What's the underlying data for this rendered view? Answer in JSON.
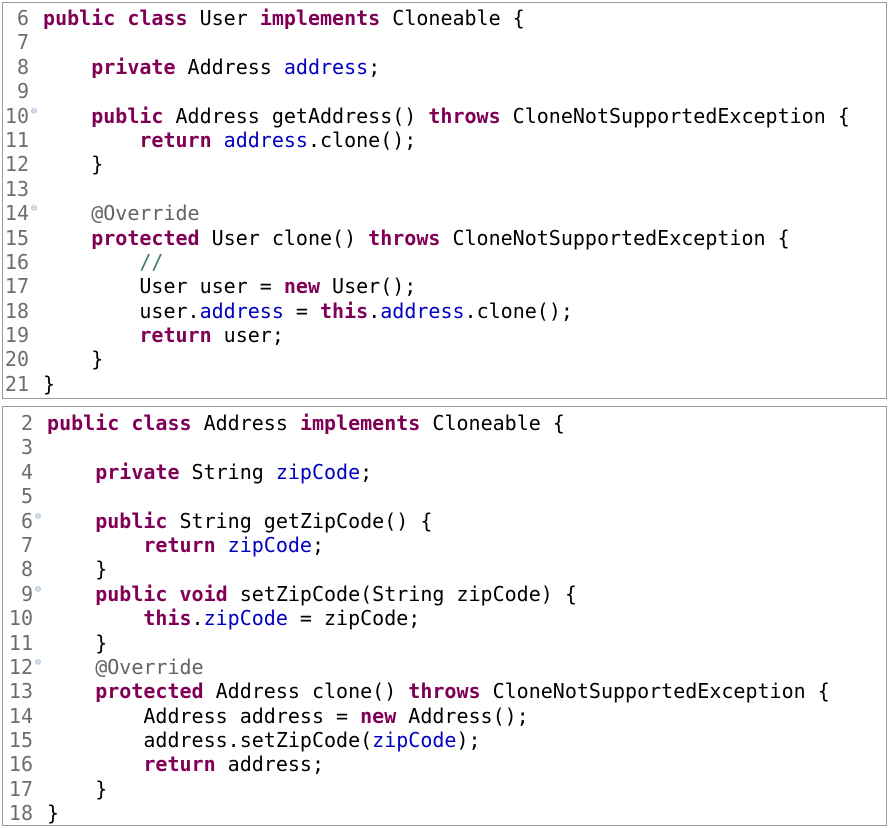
{
  "panels": [
    {
      "id": "user",
      "lines": [
        {
          "n": "6",
          "fold": false,
          "override": false,
          "tokens": [
            [
              "kw",
              "public"
            ],
            [
              "pl",
              " "
            ],
            [
              "kw",
              "class"
            ],
            [
              "pl",
              " User "
            ],
            [
              "kw",
              "implements"
            ],
            [
              "pl",
              " Cloneable {"
            ]
          ]
        },
        {
          "n": "7",
          "fold": false,
          "override": false,
          "tokens": []
        },
        {
          "n": "8",
          "fold": false,
          "override": false,
          "tokens": [
            [
              "pl",
              "    "
            ],
            [
              "kw",
              "private"
            ],
            [
              "pl",
              " Address "
            ],
            [
              "fld",
              "address"
            ],
            [
              "pl",
              ";"
            ]
          ]
        },
        {
          "n": "9",
          "fold": false,
          "override": false,
          "tokens": []
        },
        {
          "n": "10",
          "fold": true,
          "override": false,
          "tokens": [
            [
              "pl",
              "    "
            ],
            [
              "kw",
              "public"
            ],
            [
              "pl",
              " Address getAddress() "
            ],
            [
              "kw",
              "throws"
            ],
            [
              "pl",
              " CloneNotSupportedException {"
            ]
          ]
        },
        {
          "n": "11",
          "fold": false,
          "override": false,
          "tokens": [
            [
              "pl",
              "        "
            ],
            [
              "kw",
              "return"
            ],
            [
              "pl",
              " "
            ],
            [
              "fld",
              "address"
            ],
            [
              "pl",
              ".clone();"
            ]
          ]
        },
        {
          "n": "12",
          "fold": false,
          "override": false,
          "tokens": [
            [
              "pl",
              "    }"
            ]
          ]
        },
        {
          "n": "13",
          "fold": false,
          "override": false,
          "tokens": []
        },
        {
          "n": "14",
          "fold": true,
          "override": false,
          "tokens": [
            [
              "pl",
              "    "
            ],
            [
              "ann",
              "@Override"
            ]
          ]
        },
        {
          "n": "15",
          "fold": false,
          "override": true,
          "tokens": [
            [
              "pl",
              "    "
            ],
            [
              "kw",
              "protected"
            ],
            [
              "pl",
              " User clone() "
            ],
            [
              "kw",
              "throws"
            ],
            [
              "pl",
              " CloneNotSupportedException {"
            ]
          ]
        },
        {
          "n": "16",
          "fold": false,
          "override": false,
          "tokens": [
            [
              "pl",
              "        "
            ],
            [
              "cmt",
              "//"
            ]
          ]
        },
        {
          "n": "17",
          "fold": false,
          "override": false,
          "tokens": [
            [
              "pl",
              "        User user = "
            ],
            [
              "kw",
              "new"
            ],
            [
              "pl",
              " User();"
            ]
          ]
        },
        {
          "n": "18",
          "fold": false,
          "override": false,
          "tokens": [
            [
              "pl",
              "        user."
            ],
            [
              "fld",
              "address"
            ],
            [
              "pl",
              " = "
            ],
            [
              "kw",
              "this"
            ],
            [
              "pl",
              "."
            ],
            [
              "fld",
              "address"
            ],
            [
              "pl",
              ".clone();"
            ]
          ]
        },
        {
          "n": "19",
          "fold": false,
          "override": false,
          "tokens": [
            [
              "pl",
              "        "
            ],
            [
              "kw",
              "return"
            ],
            [
              "pl",
              " user;"
            ]
          ]
        },
        {
          "n": "20",
          "fold": false,
          "override": false,
          "tokens": [
            [
              "pl",
              "    }"
            ]
          ]
        },
        {
          "n": "21",
          "fold": false,
          "override": false,
          "tokens": [
            [
              "pl",
              "}"
            ]
          ]
        }
      ]
    },
    {
      "id": "address",
      "lines": [
        {
          "n": "2",
          "fold": false,
          "override": false,
          "tokens": [
            [
              "kw",
              "public"
            ],
            [
              "pl",
              " "
            ],
            [
              "kw",
              "class"
            ],
            [
              "pl",
              " Address "
            ],
            [
              "kw",
              "implements"
            ],
            [
              "pl",
              " Cloneable {"
            ]
          ]
        },
        {
          "n": "3",
          "fold": false,
          "override": false,
          "tokens": []
        },
        {
          "n": "4",
          "fold": false,
          "override": false,
          "tokens": [
            [
              "pl",
              "    "
            ],
            [
              "kw",
              "private"
            ],
            [
              "pl",
              " String "
            ],
            [
              "fld",
              "zipCode"
            ],
            [
              "pl",
              ";"
            ]
          ]
        },
        {
          "n": "5",
          "fold": false,
          "override": false,
          "tokens": []
        },
        {
          "n": "6",
          "fold": true,
          "override": false,
          "tokens": [
            [
              "pl",
              "    "
            ],
            [
              "kw",
              "public"
            ],
            [
              "pl",
              " String getZipCode() {"
            ]
          ]
        },
        {
          "n": "7",
          "fold": false,
          "override": false,
          "tokens": [
            [
              "pl",
              "        "
            ],
            [
              "kw",
              "return"
            ],
            [
              "pl",
              " "
            ],
            [
              "fld",
              "zipCode"
            ],
            [
              "pl",
              ";"
            ]
          ]
        },
        {
          "n": "8",
          "fold": false,
          "override": false,
          "tokens": [
            [
              "pl",
              "    }"
            ]
          ]
        },
        {
          "n": "9",
          "fold": true,
          "override": false,
          "tokens": [
            [
              "pl",
              "    "
            ],
            [
              "kw",
              "public"
            ],
            [
              "pl",
              " "
            ],
            [
              "kw",
              "void"
            ],
            [
              "pl",
              " setZipCode(String zipCode) {"
            ]
          ]
        },
        {
          "n": "10",
          "fold": false,
          "override": false,
          "tokens": [
            [
              "pl",
              "        "
            ],
            [
              "kw",
              "this"
            ],
            [
              "pl",
              "."
            ],
            [
              "fld",
              "zipCode"
            ],
            [
              "pl",
              " = zipCode;"
            ]
          ]
        },
        {
          "n": "11",
          "fold": false,
          "override": false,
          "tokens": [
            [
              "pl",
              "    }"
            ]
          ]
        },
        {
          "n": "12",
          "fold": true,
          "override": false,
          "tokens": [
            [
              "pl",
              "    "
            ],
            [
              "ann",
              "@Override"
            ]
          ]
        },
        {
          "n": "13",
          "fold": false,
          "override": true,
          "tokens": [
            [
              "pl",
              "    "
            ],
            [
              "kw",
              "protected"
            ],
            [
              "pl",
              " Address clone() "
            ],
            [
              "kw",
              "throws"
            ],
            [
              "pl",
              " CloneNotSupportedException {"
            ]
          ]
        },
        {
          "n": "14",
          "fold": false,
          "override": false,
          "tokens": [
            [
              "pl",
              "        Address address = "
            ],
            [
              "kw",
              "new"
            ],
            [
              "pl",
              " Address();"
            ]
          ]
        },
        {
          "n": "15",
          "fold": false,
          "override": false,
          "tokens": [
            [
              "pl",
              "        address.setZipCode("
            ],
            [
              "fld",
              "zipCode"
            ],
            [
              "pl",
              ");"
            ]
          ]
        },
        {
          "n": "16",
          "fold": false,
          "override": false,
          "tokens": [
            [
              "pl",
              "        "
            ],
            [
              "kw",
              "return"
            ],
            [
              "pl",
              " address;"
            ]
          ]
        },
        {
          "n": "17",
          "fold": false,
          "override": false,
          "tokens": [
            [
              "pl",
              "    }"
            ]
          ]
        },
        {
          "n": "18",
          "fold": false,
          "override": false,
          "tokens": [
            [
              "pl",
              "}"
            ]
          ]
        }
      ]
    }
  ],
  "icons": {
    "fold": "fold-collapse-icon",
    "override": "override-arrow-icon"
  },
  "colors": {
    "keyword": "#7f0055",
    "field": "#0000c0",
    "annotation": "#646464",
    "comment": "#3f7f5f",
    "line_number": "#6e6e6e"
  }
}
